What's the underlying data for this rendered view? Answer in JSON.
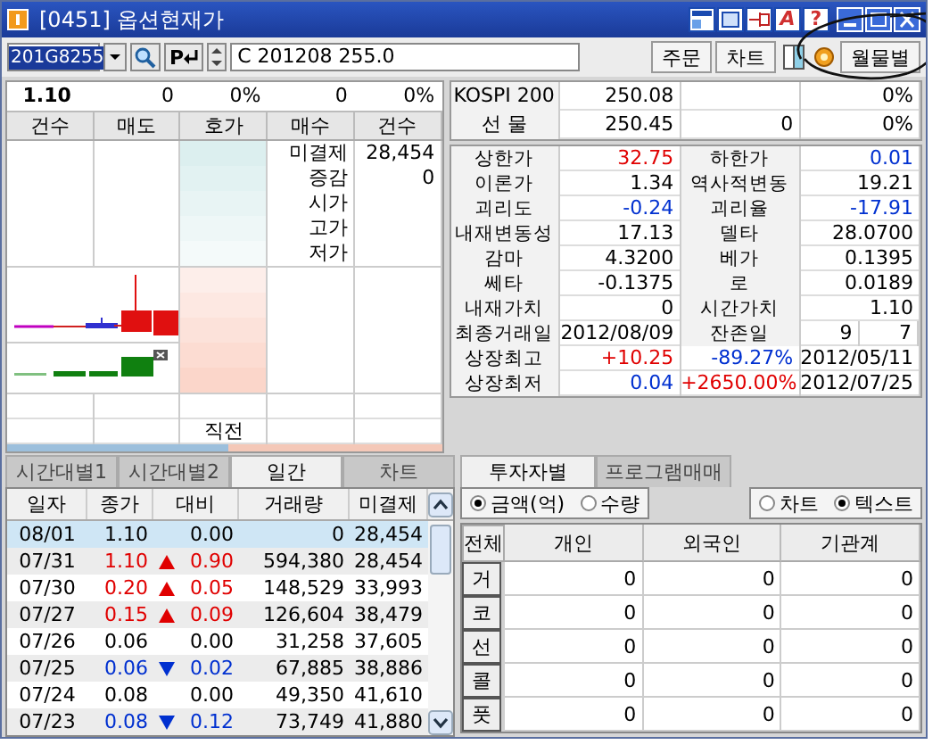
{
  "window": {
    "title": "[0451] 옵션현재가",
    "tool_letters": [
      "A",
      "?"
    ]
  },
  "toolbar": {
    "code": "201G8255",
    "p_button": "P",
    "contract": "C 201208 255.0",
    "buttons": [
      "주문",
      "차트"
    ],
    "monthly_button": "월물별"
  },
  "quote": [
    "1.10",
    "0",
    "0%",
    "0",
    "0%"
  ],
  "order_book": {
    "columns": [
      "건수",
      "매도",
      "호가",
      "매수",
      "건수"
    ],
    "info": [
      {
        "label": "미결제",
        "value": "28,454"
      },
      {
        "label": "증감",
        "value": "0"
      },
      {
        "label": "시가"
      },
      {
        "label": "고가"
      },
      {
        "label": "저가"
      }
    ],
    "last_label": "직전",
    "ratio_bar": {
      "level": 0.51
    }
  },
  "market": [
    {
      "label": "KOSPI 200",
      "value": "250.08",
      "rate": "0%"
    },
    {
      "label": "선 물",
      "value": "250.45",
      "change": "0",
      "rate": "0%"
    }
  ],
  "stats": [
    {
      "cells": [
        {
          "kind": "label",
          "text": "상한가"
        },
        {
          "kind": "value",
          "text": "32.75",
          "color": "#e00000"
        },
        {
          "kind": "label",
          "text": "하한가"
        },
        {
          "kind": "value",
          "text": "0.01",
          "color": "#0030d0"
        }
      ]
    },
    {
      "cells": [
        {
          "kind": "label",
          "text": "이론가"
        },
        {
          "kind": "value",
          "text": "1.34"
        },
        {
          "kind": "label",
          "text": "역사적변동"
        },
        {
          "kind": "value",
          "text": "19.21"
        }
      ]
    },
    {
      "cells": [
        {
          "kind": "label",
          "text": "괴리도"
        },
        {
          "kind": "value",
          "text": "-0.24",
          "color": "#0030d0"
        },
        {
          "kind": "label",
          "text": "괴리율"
        },
        {
          "kind": "value",
          "text": "-17.91",
          "color": "#0030d0"
        }
      ]
    },
    {
      "cells": [
        {
          "kind": "label",
          "text": "내재변동성"
        },
        {
          "kind": "value",
          "text": "17.13"
        },
        {
          "kind": "label",
          "text": "델타"
        },
        {
          "kind": "value",
          "text": "28.0700"
        }
      ]
    },
    {
      "cells": [
        {
          "kind": "label",
          "text": "감마"
        },
        {
          "kind": "value",
          "text": "4.3200"
        },
        {
          "kind": "label",
          "text": "베가"
        },
        {
          "kind": "value",
          "text": "0.1395"
        }
      ]
    },
    {
      "cells": [
        {
          "kind": "label",
          "text": "쎄타"
        },
        {
          "kind": "value",
          "text": "-0.1375"
        },
        {
          "kind": "label",
          "text": "로"
        },
        {
          "kind": "value",
          "text": "0.0189"
        }
      ]
    },
    {
      "cells": [
        {
          "kind": "label",
          "text": "내재가치"
        },
        {
          "kind": "value",
          "text": "0"
        },
        {
          "kind": "label",
          "text": "시간가치"
        },
        {
          "kind": "value",
          "text": "1.10"
        }
      ]
    },
    {
      "cells": [
        {
          "kind": "label",
          "text": "최종거래일"
        },
        {
          "kind": "value",
          "text": "2012/08/09"
        },
        {
          "kind": "label",
          "text": "잔존일"
        },
        {
          "kind": "split",
          "texts": [
            "9",
            "7"
          ]
        }
      ]
    },
    {
      "cells": [
        {
          "kind": "label",
          "text": "상장최고"
        },
        {
          "kind": "value",
          "text": "+10.25",
          "color": "#e00000"
        },
        {
          "kind": "value",
          "text": "-89.27%",
          "color": "#0030d0"
        },
        {
          "kind": "value",
          "text": "2012/05/11"
        }
      ]
    },
    {
      "cells": [
        {
          "kind": "label",
          "text": "상장최저"
        },
        {
          "kind": "value",
          "text": "0.04",
          "color": "#0030d0"
        },
        {
          "kind": "value",
          "text": "+2650.00%",
          "color": "#e00000"
        },
        {
          "kind": "value",
          "text": "2012/07/25"
        }
      ]
    }
  ],
  "left_tabs": [
    {
      "label": "시간대별1",
      "selected": false
    },
    {
      "label": "시간대별2",
      "selected": false
    },
    {
      "label": "일간",
      "selected": true
    },
    {
      "label": "차트",
      "selected": false
    }
  ],
  "daily": {
    "columns": [
      "일자",
      "종가",
      "대비",
      "거래량",
      "미결제"
    ],
    "rows": [
      {
        "kind": "flat",
        "date": "08/01",
        "close": "1.10",
        "change": "0.00",
        "volume": "0",
        "open_interest": "28,454",
        "selected": true
      },
      {
        "kind": "up",
        "date": "07/31",
        "close": "1.10",
        "change": "0.90",
        "volume": "594,380",
        "open_interest": "28,454",
        "selected": false
      },
      {
        "kind": "up",
        "date": "07/30",
        "close": "0.20",
        "change": "0.05",
        "volume": "148,529",
        "open_interest": "33,993",
        "selected": false
      },
      {
        "kind": "up",
        "date": "07/27",
        "close": "0.15",
        "change": "0.09",
        "volume": "126,604",
        "open_interest": "38,479",
        "selected": false
      },
      {
        "kind": "flat",
        "date": "07/26",
        "close": "0.06",
        "change": "0.00",
        "volume": "31,258",
        "open_interest": "37,605",
        "selected": false
      },
      {
        "kind": "down",
        "date": "07/25",
        "close": "0.06",
        "change": "0.02",
        "volume": "67,885",
        "open_interest": "38,886",
        "selected": false
      },
      {
        "kind": "flat",
        "date": "07/24",
        "close": "0.08",
        "change": "0.00",
        "volume": "49,350",
        "open_interest": "41,610",
        "selected": false
      },
      {
        "kind": "down",
        "date": "07/23",
        "close": "0.08",
        "change": "0.12",
        "volume": "73,749",
        "open_interest": "41,880",
        "selected": false
      }
    ]
  },
  "right_tabs": [
    {
      "label": "투자자별",
      "selected": true
    },
    {
      "label": "프로그램매매",
      "selected": false
    }
  ],
  "investor": {
    "units": [
      {
        "label": "금액(억)",
        "selected": true
      },
      {
        "label": "수량",
        "selected": false
      }
    ],
    "views": [
      {
        "label": "차트",
        "selected": false
      },
      {
        "label": "텍스트",
        "selected": true
      }
    ],
    "corner": "전체",
    "columns": [
      "개인",
      "외국인",
      "기관계"
    ],
    "rows": [
      {
        "market": "거",
        "values": [
          "0",
          "0",
          "0"
        ]
      },
      {
        "market": "코",
        "values": [
          "0",
          "0",
          "0"
        ]
      },
      {
        "market": "선",
        "values": [
          "0",
          "0",
          "0"
        ]
      },
      {
        "market": "콜",
        "values": [
          "0",
          "0",
          "0"
        ]
      },
      {
        "market": "풋",
        "values": [
          "0",
          "0",
          "0"
        ]
      }
    ]
  }
}
